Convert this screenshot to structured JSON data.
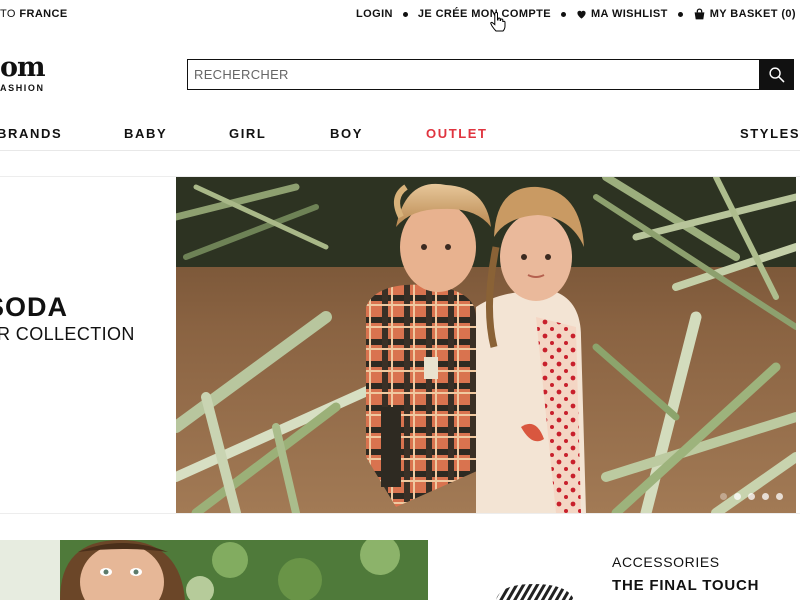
{
  "topbar": {
    "ship_prefix": "TO",
    "ship_country": "FRANCE",
    "links": {
      "login": "LOGIN",
      "account": "JE CRÉE MON COMPTE",
      "wishlist": "MA WISHLIST",
      "basket": "MY BASKET (0)"
    }
  },
  "logo": {
    "word": "om",
    "tagline": "ASHION"
  },
  "search": {
    "placeholder": "RECHERCHER",
    "value": ""
  },
  "nav": {
    "brands": "BRANDS",
    "baby": "BABY",
    "girl": "GIRL",
    "boy": "BOY",
    "outlet": "OUTLET",
    "styles": "STYLES"
  },
  "hero": {
    "title": "SODA",
    "subtitle": "R COLLECTION",
    "slides_total": 5,
    "slide_active": 1
  },
  "promo": {
    "kicker": "ACCESSORIES",
    "title": "THE FINAL TOUCH"
  },
  "colors": {
    "text": "#111111",
    "outlet": "#e0343f",
    "search_button": "#111111"
  },
  "icons": [
    "heart-icon",
    "basket-icon",
    "search-icon",
    "hand-cursor-icon"
  ]
}
